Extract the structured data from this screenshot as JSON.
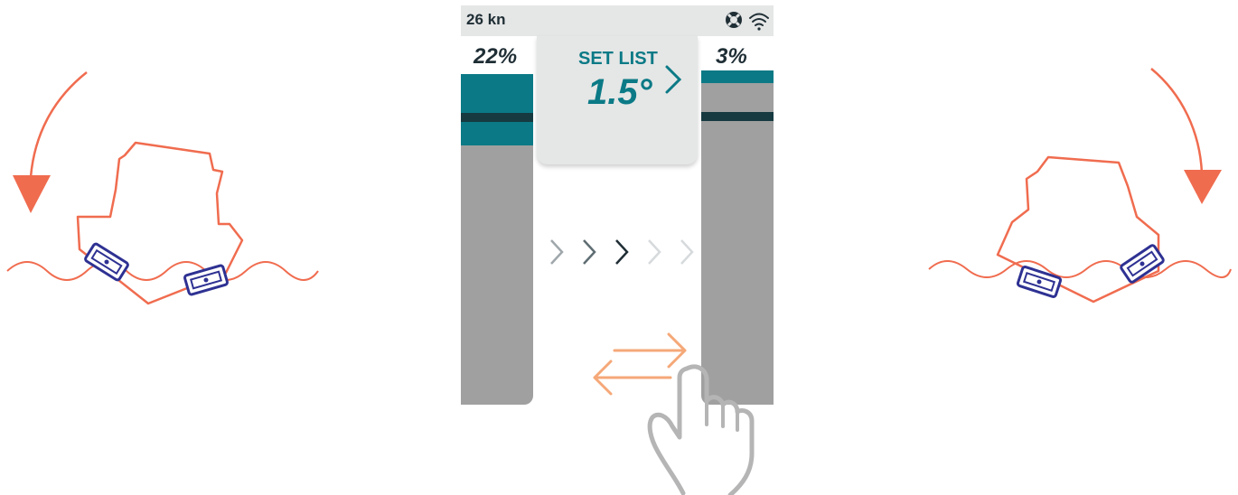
{
  "status_bar": {
    "speed": "26 kn",
    "icons": [
      "lifebuoy-icon",
      "wifi-icon"
    ]
  },
  "left_tab": {
    "percent": "22%",
    "fill_fraction": 0.22
  },
  "right_tab": {
    "percent": "3%",
    "fill_fraction": 0.03
  },
  "set_list": {
    "label": "SET LIST",
    "value": "1.5°"
  },
  "colors": {
    "accent": "#0b7a86",
    "dark": "#1f2e35",
    "illustration": "#f06c4f",
    "trim_tab": "#2e3192",
    "swipe": "#f5a878"
  }
}
